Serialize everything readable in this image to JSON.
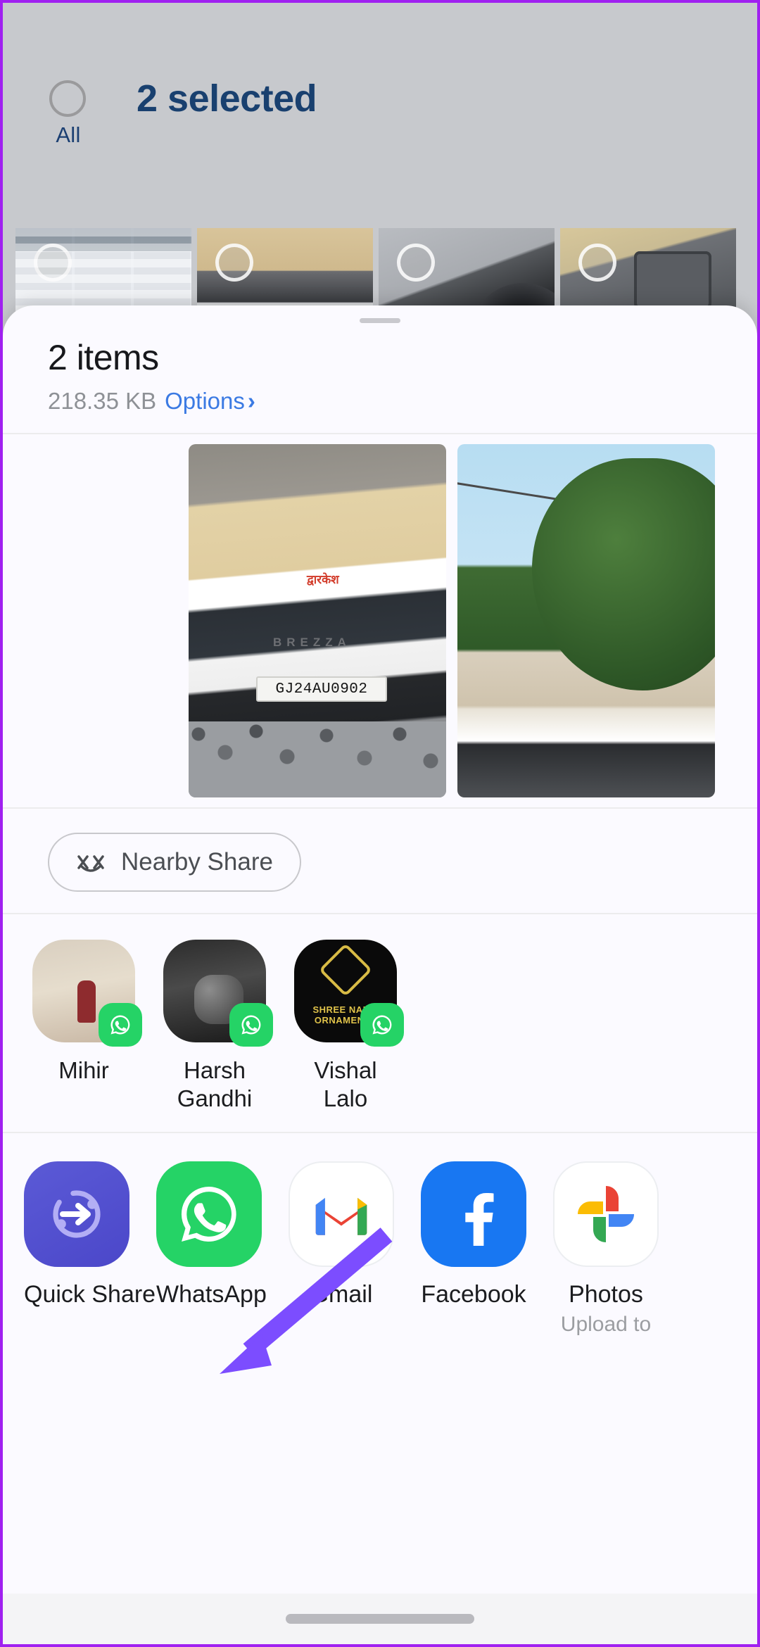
{
  "gallery": {
    "select_all_label": "All",
    "selection_title": "2 selected",
    "thumbnails": [
      {
        "name": "screenshot-collage"
      },
      {
        "name": "white-car-side"
      },
      {
        "name": "wheel-arch-closeup"
      },
      {
        "name": "car-infotainment-screen"
      }
    ]
  },
  "sheet": {
    "title": "2 items",
    "size": "218.35 KB",
    "options_label": "Options",
    "options_chevron": "›",
    "previews": [
      {
        "name": "brezza-rear-photo",
        "plate": "GJ24AU0902",
        "badge": "BREZZA",
        "sticker": "द्वारकेश"
      },
      {
        "name": "car-front-tree-photo"
      }
    ],
    "nearby": {
      "label": "Nearby Share",
      "icon": "nearby-share-icon"
    },
    "contacts": [
      {
        "name": "Mihir",
        "app_badge": "whatsapp-icon"
      },
      {
        "name": "Harsh Gandhi",
        "app_badge": "whatsapp-icon"
      },
      {
        "name": "Vishal Lalo",
        "app_badge": "whatsapp-icon",
        "avatar_text": "SHREE NAMO ORNAMENTS"
      }
    ],
    "apps": [
      {
        "name": "Quick Share",
        "sub": "",
        "icon": "quick-share-icon"
      },
      {
        "name": "WhatsApp",
        "sub": "",
        "icon": "whatsapp-icon"
      },
      {
        "name": "Gmail",
        "sub": "",
        "icon": "gmail-icon"
      },
      {
        "name": "Facebook",
        "sub": "",
        "icon": "facebook-icon"
      },
      {
        "name": "Photos",
        "sub": "Upload to",
        "icon": "google-photos-icon"
      }
    ]
  },
  "colors": {
    "accent_blue": "#3b7ae3",
    "selection_blue": "#19406f",
    "whatsapp_green": "#25d366",
    "facebook_blue": "#1877f2",
    "annotation_purple": "#7c4dff"
  }
}
